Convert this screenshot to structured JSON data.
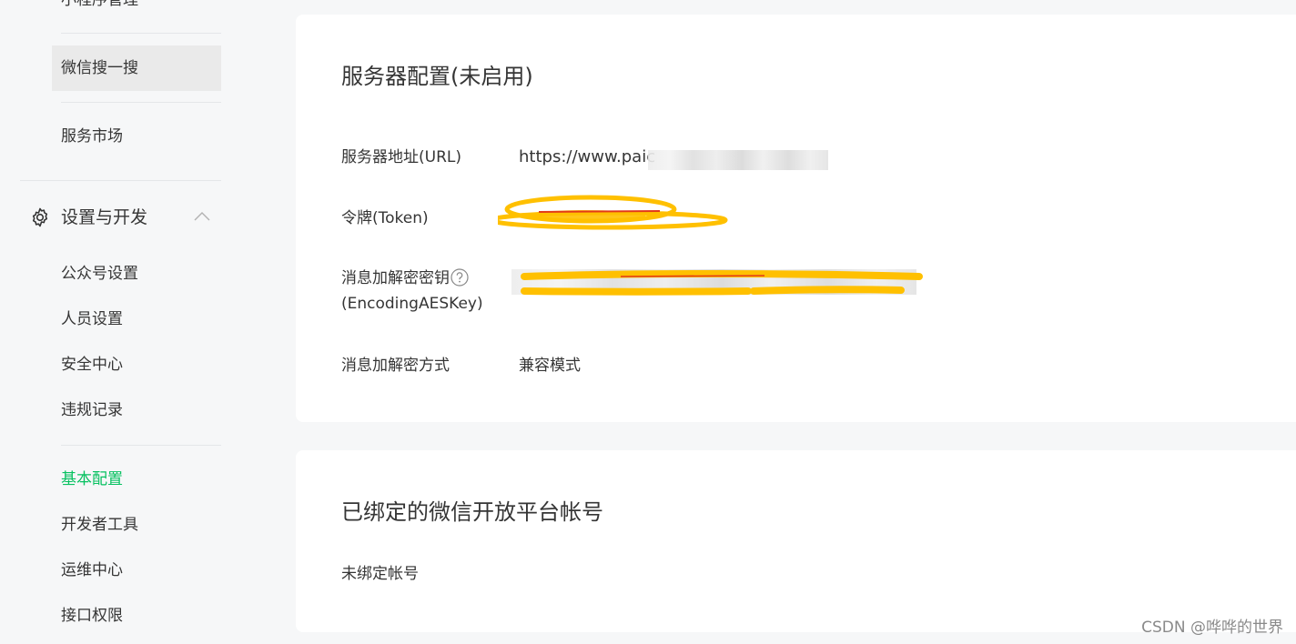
{
  "sidebar": {
    "items_top": [
      {
        "label": "小程序管理"
      },
      {
        "label": "微信搜一搜"
      },
      {
        "label": "服务市场"
      }
    ],
    "group": {
      "label": "设置与开发",
      "icon": "gear-icon",
      "expanded": true
    },
    "group_items": [
      {
        "label": "公众号设置"
      },
      {
        "label": "人员设置"
      },
      {
        "label": "安全中心"
      },
      {
        "label": "违规记录"
      },
      {
        "label": "基本配置",
        "active": true
      },
      {
        "label": "开发者工具"
      },
      {
        "label": "运维中心"
      },
      {
        "label": "接口权限"
      }
    ],
    "active_color": "#07c160"
  },
  "server_config": {
    "title": "服务器配置(未启用)",
    "url_label": "服务器地址(URL)",
    "url_value": "https://www.paic",
    "token_label": "令牌(Token)",
    "aes_label_line1": "消息加解密密钥",
    "aes_label_line2": "(EncodingAESKey)",
    "mode_label": "消息加解密方式",
    "mode_value": "兼容模式"
  },
  "open_platform": {
    "title": "已绑定的微信开放平台帐号",
    "status": "未绑定帐号"
  },
  "watermark": "CSDN @哗哗的世界"
}
